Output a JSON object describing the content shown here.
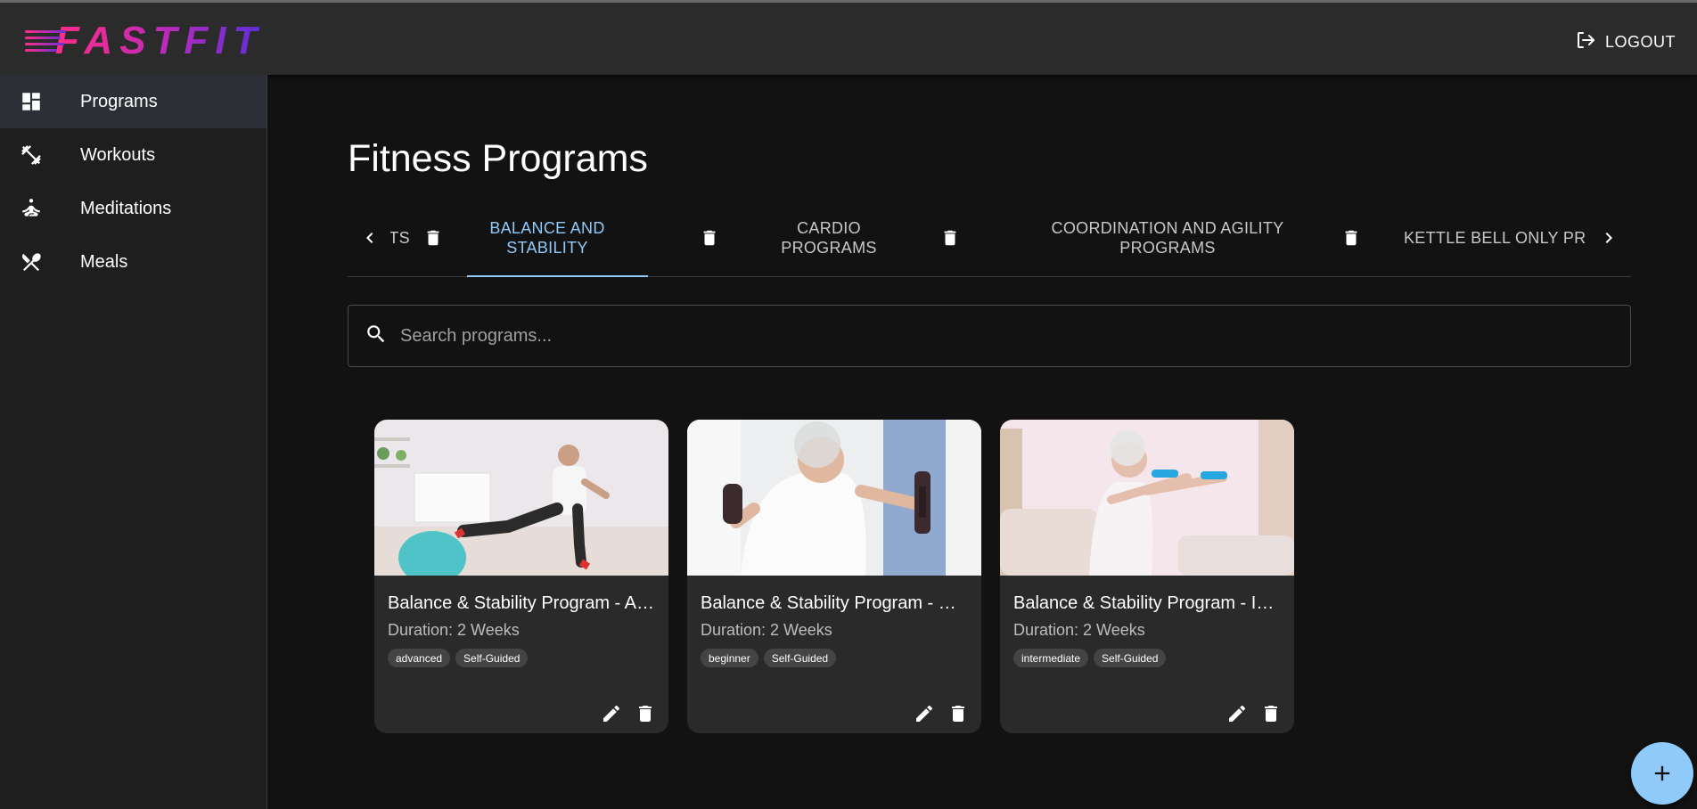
{
  "app": {
    "logo_text": "FASTFIT",
    "brand_gradient": [
      "#ff2e86",
      "#5b2fd8"
    ],
    "accent": "#90caf9"
  },
  "header": {
    "logout_label": "LOGOUT",
    "logout_icon": "logout-icon"
  },
  "sidebar": {
    "items": [
      {
        "label": "Programs",
        "icon": "dashboard-icon",
        "active": true
      },
      {
        "label": "Workouts",
        "icon": "dumbbell-icon",
        "active": false
      },
      {
        "label": "Meditations",
        "icon": "meditation-icon",
        "active": false
      },
      {
        "label": "Meals",
        "icon": "utensils-icon",
        "active": false
      }
    ]
  },
  "main": {
    "title": "Fitness Programs",
    "tabs": [
      {
        "label": "TS",
        "active": false
      },
      {
        "label": "BALANCE AND STABILITY",
        "active": true
      },
      {
        "label": "CARDIO PROGRAMS",
        "active": false
      },
      {
        "label": "COORDINATION AND AGILITY PROGRAMS",
        "active": false
      },
      {
        "label": "KETTLE BELL ONLY PRO",
        "active": false
      }
    ],
    "search": {
      "placeholder": "Search programs..."
    },
    "cards": [
      {
        "title": "Balance & Stability Program - Advanced",
        "duration": "Duration: 2 Weeks",
        "tags": [
          "advanced",
          "Self-Guided"
        ]
      },
      {
        "title": "Balance & Stability Program - Beginner",
        "duration": "Duration: 2 Weeks",
        "tags": [
          "beginner",
          "Self-Guided"
        ]
      },
      {
        "title": "Balance & Stability Program - Intermediate",
        "duration": "Duration: 2 Weeks",
        "tags": [
          "intermediate",
          "Self-Guided"
        ]
      }
    ]
  }
}
